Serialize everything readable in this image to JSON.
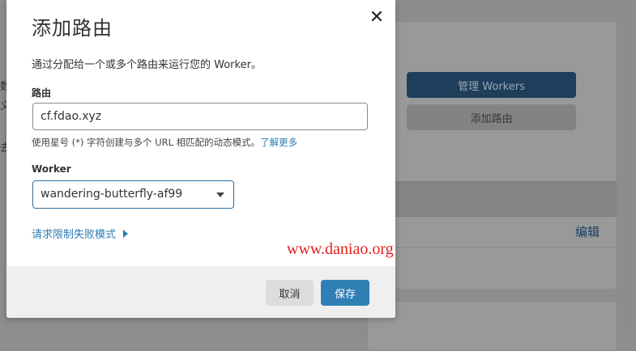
{
  "background": {
    "manage_workers_label": "管理 Workers",
    "add_route_label": "添加路由",
    "edit_label": "编辑",
    "left_fragments": [
      "数",
      "义",
      "去"
    ]
  },
  "modal": {
    "title": "添加路由",
    "close_icon": "close-icon",
    "description": "通过分配给一个或多个路由来运行您的 Worker。",
    "route": {
      "label": "路由",
      "value": "cf.fdao.xyz",
      "help_text": "使用星号 (*) 字符创建与多个 URL 相匹配的动态模式。",
      "help_link": "了解更多"
    },
    "worker": {
      "label": "Worker",
      "selected": "wandering-butterfly-af99"
    },
    "fail_mode_link": "请求限制失败模式",
    "cancel_label": "取消",
    "save_label": "保存"
  },
  "watermark": "www.daniao.org",
  "colors": {
    "primary": "#2f7fb5",
    "link": "#2c7cb0",
    "watermark": "#e0201c"
  }
}
